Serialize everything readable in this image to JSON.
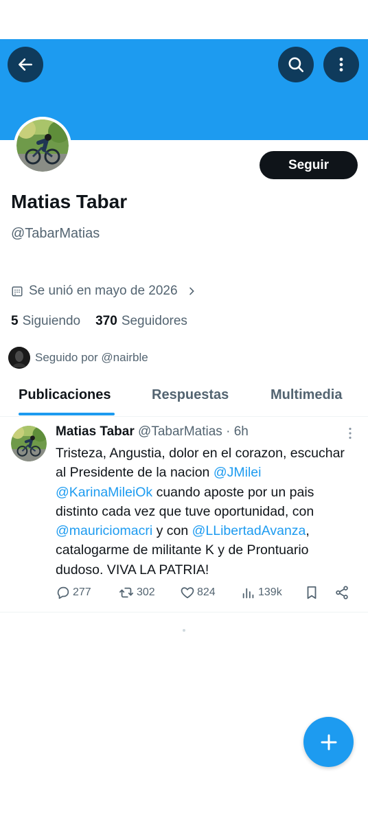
{
  "header": {
    "back_icon": "arrow-left-icon",
    "search_icon": "search-icon",
    "more_icon": "more-vertical-icon",
    "banner_color": "#1d9bf0"
  },
  "profile": {
    "follow_label": "Seguir",
    "display_name": "Matias Tabar",
    "handle": "@TabarMatias",
    "joined": "Se unió en mayo de 2026",
    "following_count": "5",
    "following_label": "Siguiendo",
    "followers_count": "370",
    "followers_label": "Seguidores",
    "followed_by": "Seguido por @nairble"
  },
  "tabs": [
    {
      "label": "Publicaciones",
      "active": true
    },
    {
      "label": "Respuestas",
      "active": false
    },
    {
      "label": "Multimedia",
      "active": false
    }
  ],
  "tweet": {
    "name": "Matias Tabar",
    "meta": "@TabarMatias · 6h",
    "text_1": "Tristeza, Angustia, dolor en el corazon, escuchar al Presidente de la nacion ",
    "mention_1": "@JMilei",
    "mention_2": "@KarinaMileiOk",
    "text_2": "  cuando aposte por un pais distinto cada vez que tuve oportunidad, con ",
    "mention_3": "@mauriciomacri",
    "text_3": " y con ",
    "mention_4": "@LLibertadAvanza",
    "text_4": ", catalogarme de militante K y de Prontuario dudoso.  VIVA LA PATRIA!",
    "replies": "277",
    "retweets": "302",
    "likes": "824",
    "views": "139k"
  },
  "colors": {
    "accent": "#1d9bf0",
    "text": "#0f1419",
    "secondary": "#536471"
  }
}
